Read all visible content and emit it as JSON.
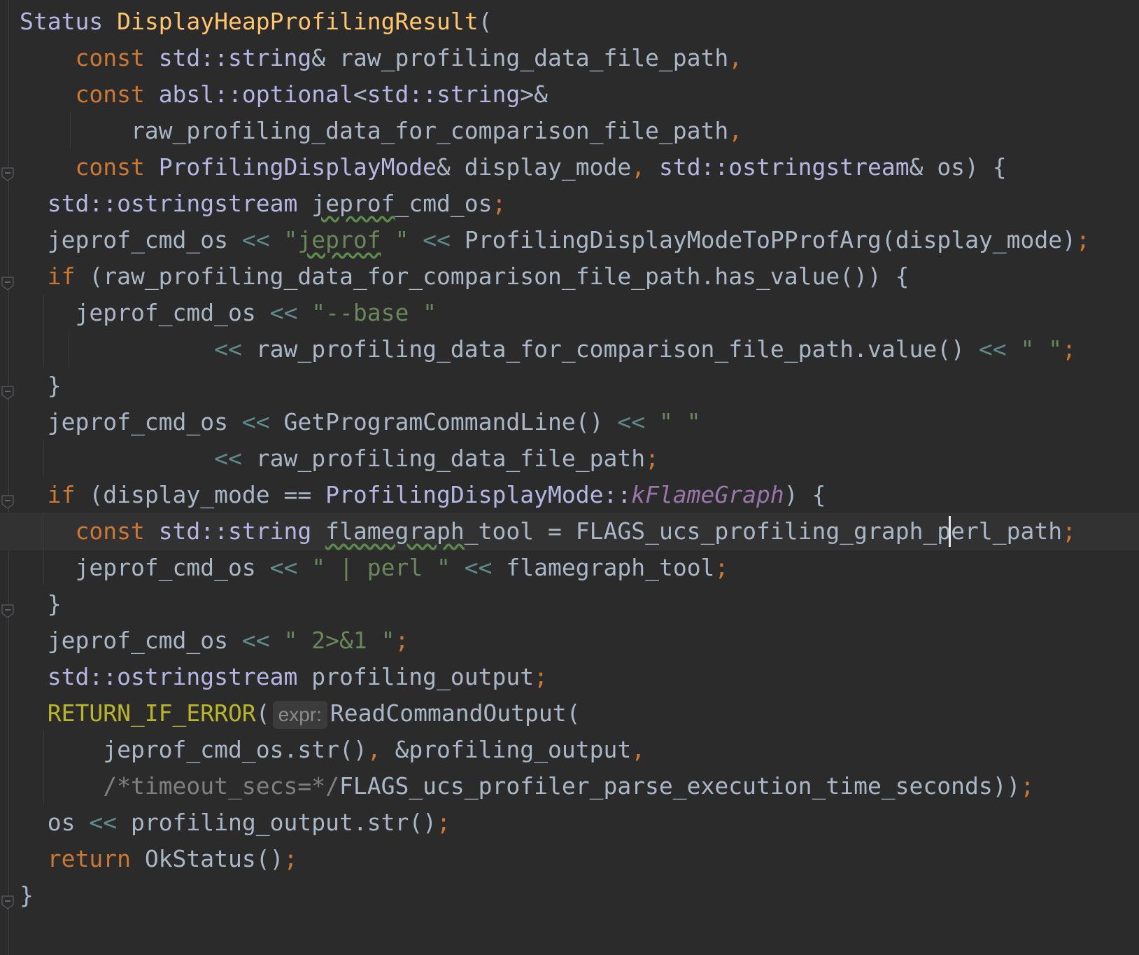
{
  "editor": {
    "current_line_index": 14,
    "inlay_hint_expr": "expr:",
    "lines": [
      [
        {
          "t": "Status ",
          "c": "t-type"
        },
        {
          "t": "DisplayHeapProfilingResult",
          "c": "t-func"
        },
        {
          "t": "(",
          "c": "t-plain"
        }
      ],
      [
        {
          "t": "    const ",
          "c": "t-keyword"
        },
        {
          "t": "std::string",
          "c": "t-type"
        },
        {
          "t": "& raw_profiling_data_file_path",
          "c": "t-plain"
        },
        {
          "t": ",",
          "c": "t-punct"
        }
      ],
      [
        {
          "t": "    const ",
          "c": "t-keyword"
        },
        {
          "t": "absl::optional",
          "c": "t-type"
        },
        {
          "t": "<",
          "c": "t-plain"
        },
        {
          "t": "std::string",
          "c": "t-type"
        },
        {
          "t": ">&",
          "c": "t-plain"
        }
      ],
      [
        {
          "t": "        raw_profiling_data_for_comparison_file_path",
          "c": "t-plain"
        },
        {
          "t": ",",
          "c": "t-punct"
        }
      ],
      [
        {
          "t": "    const ",
          "c": "t-keyword"
        },
        {
          "t": "ProfilingDisplayMode",
          "c": "t-type"
        },
        {
          "t": "& display_mode",
          "c": "t-plain"
        },
        {
          "t": ", ",
          "c": "t-punct"
        },
        {
          "t": "std::ostringstream",
          "c": "t-type"
        },
        {
          "t": "& os) {",
          "c": "t-plain"
        }
      ],
      [
        {
          "t": "  std::ostringstream ",
          "c": "t-type"
        },
        {
          "t": "jeprof",
          "c": "t-plain t-typo"
        },
        {
          "t": "_cmd_os",
          "c": "t-plain"
        },
        {
          "t": ";",
          "c": "t-punct"
        }
      ],
      [
        {
          "t": "  jeprof_cmd_os ",
          "c": "t-plain"
        },
        {
          "t": "<<",
          "c": "t-op"
        },
        {
          "t": " \"",
          "c": "t-string"
        },
        {
          "t": "jeprof",
          "c": "t-string t-typo"
        },
        {
          "t": " \" ",
          "c": "t-string"
        },
        {
          "t": "<<",
          "c": "t-op"
        },
        {
          "t": " ProfilingDisplayModeToPProfArg(display_mode)",
          "c": "t-plain"
        },
        {
          "t": ";",
          "c": "t-punct"
        }
      ],
      [
        {
          "t": "  if ",
          "c": "t-keyword"
        },
        {
          "t": "(raw_profiling_data_for_comparison_file_path.has_value()) {",
          "c": "t-plain"
        }
      ],
      [
        {
          "t": "    jeprof_cmd_os ",
          "c": "t-plain"
        },
        {
          "t": "<<",
          "c": "t-op"
        },
        {
          "t": " \"--base \"",
          "c": "t-string"
        }
      ],
      [
        {
          "t": "              ",
          "c": "t-plain"
        },
        {
          "t": "<<",
          "c": "t-op"
        },
        {
          "t": " raw_profiling_data_for_comparison_file_path.value() ",
          "c": "t-plain"
        },
        {
          "t": "<<",
          "c": "t-op"
        },
        {
          "t": " \" \"",
          "c": "t-string"
        },
        {
          "t": ";",
          "c": "t-punct"
        }
      ],
      [
        {
          "t": "  }",
          "c": "t-plain"
        }
      ],
      [
        {
          "t": "  jeprof_cmd_os ",
          "c": "t-plain"
        },
        {
          "t": "<<",
          "c": "t-op"
        },
        {
          "t": " GetProgramCommandLine() ",
          "c": "t-plain"
        },
        {
          "t": "<<",
          "c": "t-op"
        },
        {
          "t": " \" \"",
          "c": "t-string"
        }
      ],
      [
        {
          "t": "              ",
          "c": "t-plain"
        },
        {
          "t": "<<",
          "c": "t-op"
        },
        {
          "t": " raw_profiling_data_file_path",
          "c": "t-plain"
        },
        {
          "t": ";",
          "c": "t-punct"
        }
      ],
      [
        {
          "t": "  if ",
          "c": "t-keyword"
        },
        {
          "t": "(display_mode == ",
          "c": "t-plain"
        },
        {
          "t": "ProfilingDisplayMode::",
          "c": "t-type"
        },
        {
          "t": "kFlameGraph",
          "c": "t-enum"
        },
        {
          "t": ") {",
          "c": "t-plain"
        }
      ],
      [
        {
          "t": "    const ",
          "c": "t-keyword"
        },
        {
          "t": "std::string ",
          "c": "t-type"
        },
        {
          "t": "flamegraph",
          "c": "t-plain t-typo"
        },
        {
          "t": "_tool = FLAGS_ucs_profiling_graph_perl_path",
          "c": "t-plain"
        },
        {
          "t": ";",
          "c": "t-punct"
        }
      ],
      [
        {
          "t": "    jeprof_cmd_os ",
          "c": "t-plain"
        },
        {
          "t": "<<",
          "c": "t-op"
        },
        {
          "t": " \" | perl \" ",
          "c": "t-string"
        },
        {
          "t": "<<",
          "c": "t-op"
        },
        {
          "t": " flamegraph_tool",
          "c": "t-plain"
        },
        {
          "t": ";",
          "c": "t-punct"
        }
      ],
      [
        {
          "t": "  }",
          "c": "t-plain"
        }
      ],
      [
        {
          "t": "  jeprof_cmd_os ",
          "c": "t-plain"
        },
        {
          "t": "<<",
          "c": "t-op"
        },
        {
          "t": " \" 2>&1 \"",
          "c": "t-string"
        },
        {
          "t": ";",
          "c": "t-punct"
        }
      ],
      [
        {
          "t": "  std::ostringstream ",
          "c": "t-type"
        },
        {
          "t": "profiling_output",
          "c": "t-plain"
        },
        {
          "t": ";",
          "c": "t-punct"
        }
      ],
      [
        {
          "t": "  RETURN_IF_ERROR",
          "c": "t-macro"
        },
        {
          "t": "(",
          "c": "t-plain"
        },
        {
          "hint": true
        },
        {
          "t": "ReadCommandOutput(",
          "c": "t-plain"
        }
      ],
      [
        {
          "t": "      jeprof_cmd_os.str()",
          "c": "t-plain"
        },
        {
          "t": ", ",
          "c": "t-punct"
        },
        {
          "t": "&profiling_output",
          "c": "t-plain"
        },
        {
          "t": ",",
          "c": "t-punct"
        }
      ],
      [
        {
          "t": "      /*timeout_secs=*/",
          "c": "t-comment"
        },
        {
          "t": "FLAGS_ucs_profiler_parse_execution_time_seconds))",
          "c": "t-plain"
        },
        {
          "t": ";",
          "c": "t-punct"
        }
      ],
      [
        {
          "t": "  os ",
          "c": "t-plain"
        },
        {
          "t": "<<",
          "c": "t-op"
        },
        {
          "t": " profiling_output.str()",
          "c": "t-plain"
        },
        {
          "t": ";",
          "c": "t-punct"
        }
      ],
      [
        {
          "t": "  return ",
          "c": "t-keyword"
        },
        {
          "t": "OkStatus()",
          "c": "t-plain"
        },
        {
          "t": ";",
          "c": "t-punct"
        }
      ],
      [
        {
          "t": "}",
          "c": "t-plain"
        }
      ]
    ]
  }
}
